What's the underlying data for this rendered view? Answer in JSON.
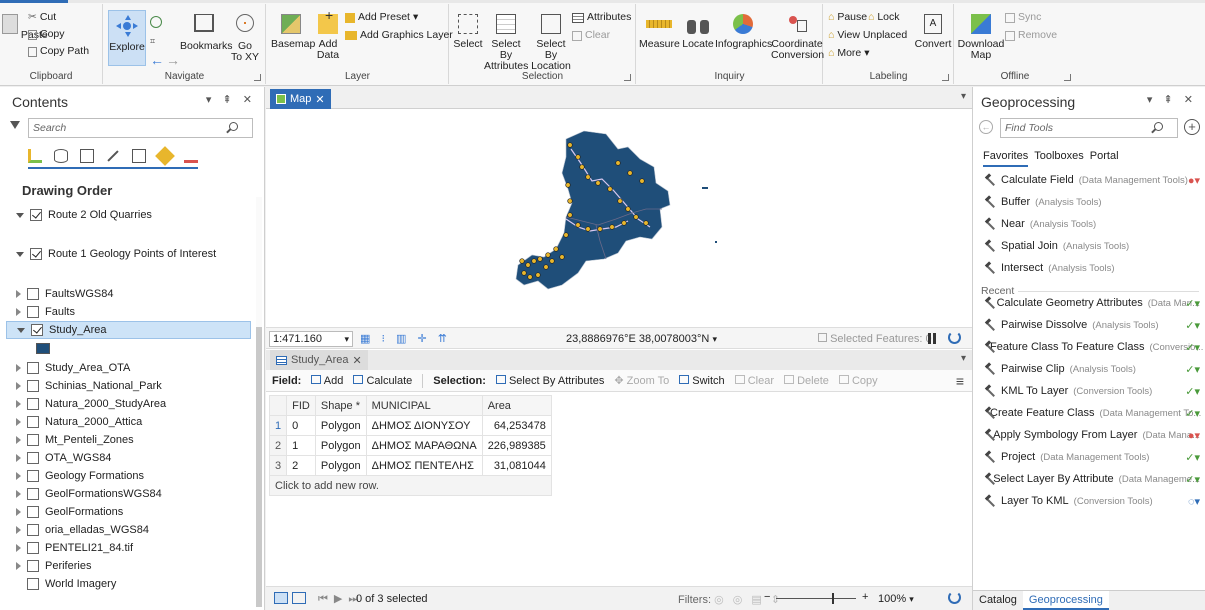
{
  "ribbon": {
    "clipboard": {
      "label": "Clipboard",
      "paste": "Paste",
      "cut": "Cut",
      "copy": "Copy",
      "copy_path": "Copy Path"
    },
    "navigate": {
      "label": "Navigate",
      "explore": "Explore",
      "bookmarks": "Bookmarks",
      "goto": "Go\nTo XY"
    },
    "layer": {
      "label": "Layer",
      "basemap": "Basemap",
      "add_data": "Add\nData",
      "add_preset": "Add Preset",
      "add_graphics": "Add Graphics Layer"
    },
    "selection": {
      "label": "Selection",
      "select": "Select",
      "select_by_attributes": "Select By\nAttributes",
      "select_by_location": "Select By\nLocation",
      "attributes": "Attributes",
      "clear": "Clear"
    },
    "inquiry": {
      "label": "Inquiry",
      "measure": "Measure",
      "locate": "Locate",
      "infographics": "Infographics",
      "coordinate_conversion": "Coordinate\nConversion"
    },
    "labeling": {
      "label": "Labeling",
      "pause": "Pause",
      "lock": "Lock",
      "view_unplaced": "View Unplaced",
      "more": "More",
      "convert": "Convert"
    },
    "offline": {
      "label": "Offline",
      "download_map": "Download\nMap",
      "sync": "Sync",
      "remove": "Remove"
    }
  },
  "contents": {
    "title": "Contents",
    "search_placeholder": "Search",
    "drawing_order": "Drawing Order",
    "layers": [
      {
        "name": "Route 2 Old Quarries",
        "checked": true,
        "open": true
      },
      {
        "name": "Route 1 Geology Points of Interest",
        "checked": true,
        "open": true
      },
      {
        "name": "FaultsWGS84",
        "checked": false,
        "open": false
      },
      {
        "name": "Faults",
        "checked": false,
        "open": false
      },
      {
        "name": "Study_Area",
        "checked": true,
        "open": true,
        "selected": true
      },
      {
        "name": "Study_Area_OTA",
        "checked": false,
        "open": false
      },
      {
        "name": "Schinias_National_Park",
        "checked": false,
        "open": false
      },
      {
        "name": "Natura_2000_StudyArea",
        "checked": false,
        "open": false
      },
      {
        "name": "Natura_2000_Attica",
        "checked": false,
        "open": false
      },
      {
        "name": "Mt_Penteli_Zones",
        "checked": false,
        "open": false
      },
      {
        "name": "OTA_WGS84",
        "checked": false,
        "open": false
      },
      {
        "name": "Geology Formations",
        "checked": false,
        "open": false
      },
      {
        "name": "GeolFormationsWGS84",
        "checked": false,
        "open": false
      },
      {
        "name": "GeolFormations",
        "checked": false,
        "open": false
      },
      {
        "name": "oria_elladas_WGS84",
        "checked": false,
        "open": false
      },
      {
        "name": "PENTELI21_84.tif",
        "checked": false,
        "open": false
      },
      {
        "name": "Periferies",
        "checked": false,
        "open": false
      },
      {
        "name": "World Imagery",
        "checked": false,
        "open": false
      }
    ],
    "study_area_swatch": "#1f4e79"
  },
  "map": {
    "tab_label": "Map",
    "scale": "1:471.160",
    "coordinates": "23,8886976°E 38,0078003°N",
    "selected_features": "Selected Features: 0",
    "polygon_color": "#1f4e79",
    "point_color": "#e8b62c",
    "route_color": "#d8c8f0"
  },
  "table": {
    "tab_label": "Study_Area",
    "toolbar": {
      "field_label": "Field:",
      "add": "Add",
      "calculate": "Calculate",
      "selection_label": "Selection:",
      "select_by_attributes": "Select By Attributes",
      "zoom_to": "Zoom To",
      "switch": "Switch",
      "clear": "Clear",
      "delete": "Delete",
      "copy": "Copy"
    },
    "columns": [
      "FID",
      "Shape *",
      "MUNICIPAL",
      "Area"
    ],
    "rows": [
      {
        "num": "1",
        "fid": "0",
        "shape": "Polygon",
        "municipal": "ΔΗΜΟΣ ΔΙΟΝΥΣΟΥ",
        "area": "64,253478"
      },
      {
        "num": "2",
        "fid": "1",
        "shape": "Polygon",
        "municipal": "ΔΗΜΟΣ ΜΑΡΑΘΩΝΑ",
        "area": "226,989385"
      },
      {
        "num": "3",
        "fid": "2",
        "shape": "Polygon",
        "municipal": "ΔΗΜΟΣ ΠΕΝΤΕΛΗΣ",
        "area": "31,081044"
      }
    ],
    "add_row_text": "Click to add new row.",
    "footer_selected": "0 of 3 selected",
    "filters": "Filters:",
    "zoom": "100%"
  },
  "geoprocessing": {
    "title": "Geoprocessing",
    "search_placeholder": "Find Tools",
    "tabs": [
      "Favorites",
      "Toolboxes",
      "Portal"
    ],
    "favorites": [
      {
        "name": "Calculate Field",
        "sub": "(Data Management Tools)",
        "status": "error"
      },
      {
        "name": "Buffer",
        "sub": "(Analysis Tools)",
        "status": ""
      },
      {
        "name": "Near",
        "sub": "(Analysis Tools)",
        "status": ""
      },
      {
        "name": "Spatial Join",
        "sub": "(Analysis Tools)",
        "status": ""
      },
      {
        "name": "Intersect",
        "sub": "(Analysis Tools)",
        "status": ""
      }
    ],
    "recent_label": "Recent",
    "recent": [
      {
        "name": "Calculate Geometry Attributes",
        "sub": "(Data Man...",
        "status": "ok"
      },
      {
        "name": "Pairwise Dissolve",
        "sub": "(Analysis Tools)",
        "status": "ok"
      },
      {
        "name": "Feature Class To Feature Class",
        "sub": "(Conversio...",
        "status": "ok"
      },
      {
        "name": "Pairwise Clip",
        "sub": "(Analysis Tools)",
        "status": "ok"
      },
      {
        "name": "KML To Layer",
        "sub": "(Conversion Tools)",
        "status": "ok"
      },
      {
        "name": "Create Feature Class",
        "sub": "(Data Management To...",
        "status": "ok"
      },
      {
        "name": "Apply Symbology From Layer",
        "sub": "(Data Mana...",
        "status": "error"
      },
      {
        "name": "Project",
        "sub": "(Data Management Tools)",
        "status": "ok"
      },
      {
        "name": "Select Layer By Attribute",
        "sub": "(Data Manageme...",
        "status": "ok"
      },
      {
        "name": "Layer To KML",
        "sub": "(Conversion Tools)",
        "status": "running"
      }
    ],
    "bottom_tabs": [
      "Catalog",
      "Geoprocessing"
    ]
  }
}
